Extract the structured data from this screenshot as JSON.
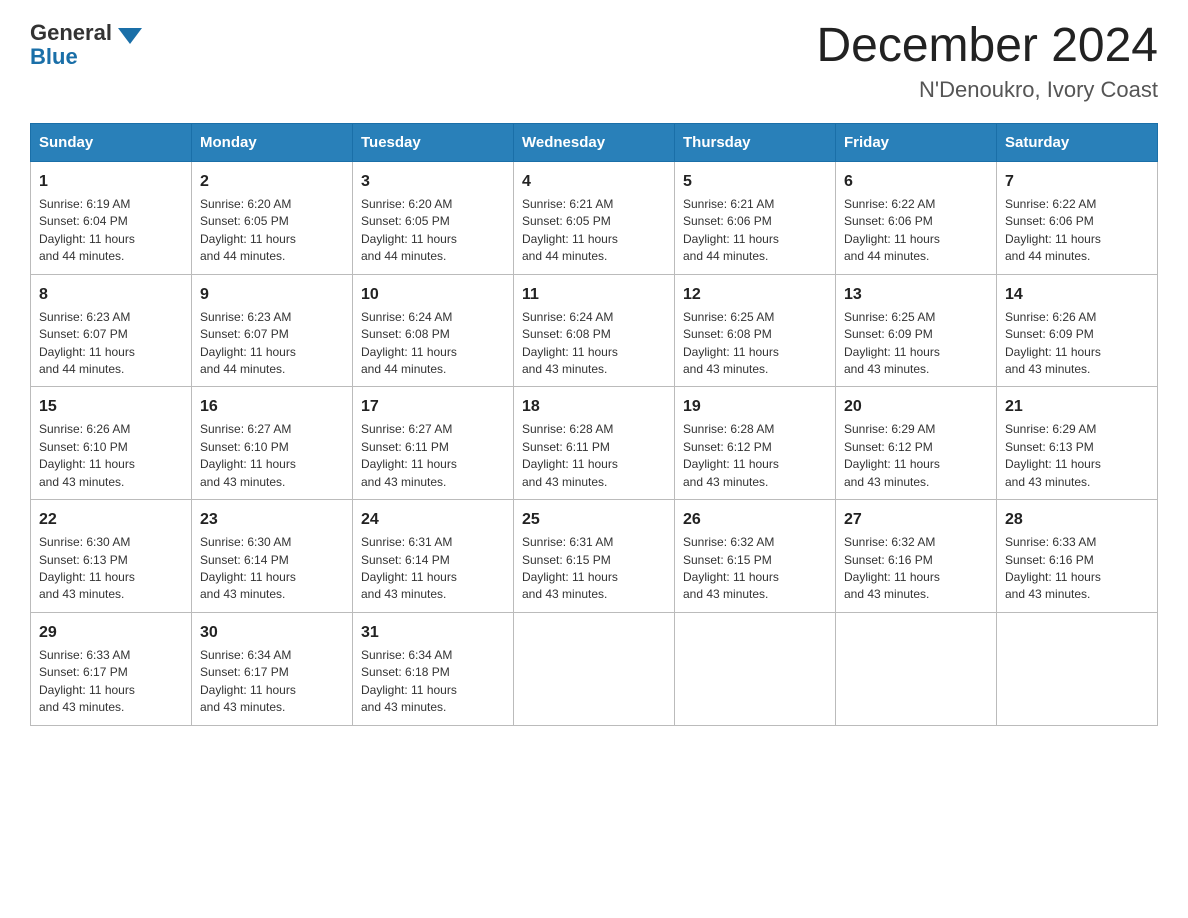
{
  "header": {
    "logo_general": "General",
    "logo_blue": "Blue",
    "main_title": "December 2024",
    "subtitle": "N'Denoukro, Ivory Coast"
  },
  "days_of_week": [
    "Sunday",
    "Monday",
    "Tuesday",
    "Wednesday",
    "Thursday",
    "Friday",
    "Saturday"
  ],
  "weeks": [
    [
      {
        "day": "1",
        "sunrise": "6:19 AM",
        "sunset": "6:04 PM",
        "daylight": "11 hours and 44 minutes."
      },
      {
        "day": "2",
        "sunrise": "6:20 AM",
        "sunset": "6:05 PM",
        "daylight": "11 hours and 44 minutes."
      },
      {
        "day": "3",
        "sunrise": "6:20 AM",
        "sunset": "6:05 PM",
        "daylight": "11 hours and 44 minutes."
      },
      {
        "day": "4",
        "sunrise": "6:21 AM",
        "sunset": "6:05 PM",
        "daylight": "11 hours and 44 minutes."
      },
      {
        "day": "5",
        "sunrise": "6:21 AM",
        "sunset": "6:06 PM",
        "daylight": "11 hours and 44 minutes."
      },
      {
        "day": "6",
        "sunrise": "6:22 AM",
        "sunset": "6:06 PM",
        "daylight": "11 hours and 44 minutes."
      },
      {
        "day": "7",
        "sunrise": "6:22 AM",
        "sunset": "6:06 PM",
        "daylight": "11 hours and 44 minutes."
      }
    ],
    [
      {
        "day": "8",
        "sunrise": "6:23 AM",
        "sunset": "6:07 PM",
        "daylight": "11 hours and 44 minutes."
      },
      {
        "day": "9",
        "sunrise": "6:23 AM",
        "sunset": "6:07 PM",
        "daylight": "11 hours and 44 minutes."
      },
      {
        "day": "10",
        "sunrise": "6:24 AM",
        "sunset": "6:08 PM",
        "daylight": "11 hours and 44 minutes."
      },
      {
        "day": "11",
        "sunrise": "6:24 AM",
        "sunset": "6:08 PM",
        "daylight": "11 hours and 43 minutes."
      },
      {
        "day": "12",
        "sunrise": "6:25 AM",
        "sunset": "6:08 PM",
        "daylight": "11 hours and 43 minutes."
      },
      {
        "day": "13",
        "sunrise": "6:25 AM",
        "sunset": "6:09 PM",
        "daylight": "11 hours and 43 minutes."
      },
      {
        "day": "14",
        "sunrise": "6:26 AM",
        "sunset": "6:09 PM",
        "daylight": "11 hours and 43 minutes."
      }
    ],
    [
      {
        "day": "15",
        "sunrise": "6:26 AM",
        "sunset": "6:10 PM",
        "daylight": "11 hours and 43 minutes."
      },
      {
        "day": "16",
        "sunrise": "6:27 AM",
        "sunset": "6:10 PM",
        "daylight": "11 hours and 43 minutes."
      },
      {
        "day": "17",
        "sunrise": "6:27 AM",
        "sunset": "6:11 PM",
        "daylight": "11 hours and 43 minutes."
      },
      {
        "day": "18",
        "sunrise": "6:28 AM",
        "sunset": "6:11 PM",
        "daylight": "11 hours and 43 minutes."
      },
      {
        "day": "19",
        "sunrise": "6:28 AM",
        "sunset": "6:12 PM",
        "daylight": "11 hours and 43 minutes."
      },
      {
        "day": "20",
        "sunrise": "6:29 AM",
        "sunset": "6:12 PM",
        "daylight": "11 hours and 43 minutes."
      },
      {
        "day": "21",
        "sunrise": "6:29 AM",
        "sunset": "6:13 PM",
        "daylight": "11 hours and 43 minutes."
      }
    ],
    [
      {
        "day": "22",
        "sunrise": "6:30 AM",
        "sunset": "6:13 PM",
        "daylight": "11 hours and 43 minutes."
      },
      {
        "day": "23",
        "sunrise": "6:30 AM",
        "sunset": "6:14 PM",
        "daylight": "11 hours and 43 minutes."
      },
      {
        "day": "24",
        "sunrise": "6:31 AM",
        "sunset": "6:14 PM",
        "daylight": "11 hours and 43 minutes."
      },
      {
        "day": "25",
        "sunrise": "6:31 AM",
        "sunset": "6:15 PM",
        "daylight": "11 hours and 43 minutes."
      },
      {
        "day": "26",
        "sunrise": "6:32 AM",
        "sunset": "6:15 PM",
        "daylight": "11 hours and 43 minutes."
      },
      {
        "day": "27",
        "sunrise": "6:32 AM",
        "sunset": "6:16 PM",
        "daylight": "11 hours and 43 minutes."
      },
      {
        "day": "28",
        "sunrise": "6:33 AM",
        "sunset": "6:16 PM",
        "daylight": "11 hours and 43 minutes."
      }
    ],
    [
      {
        "day": "29",
        "sunrise": "6:33 AM",
        "sunset": "6:17 PM",
        "daylight": "11 hours and 43 minutes."
      },
      {
        "day": "30",
        "sunrise": "6:34 AM",
        "sunset": "6:17 PM",
        "daylight": "11 hours and 43 minutes."
      },
      {
        "day": "31",
        "sunrise": "6:34 AM",
        "sunset": "6:18 PM",
        "daylight": "11 hours and 43 minutes."
      },
      null,
      null,
      null,
      null
    ]
  ],
  "labels": {
    "sunrise": "Sunrise:",
    "sunset": "Sunset:",
    "daylight": "Daylight:"
  }
}
